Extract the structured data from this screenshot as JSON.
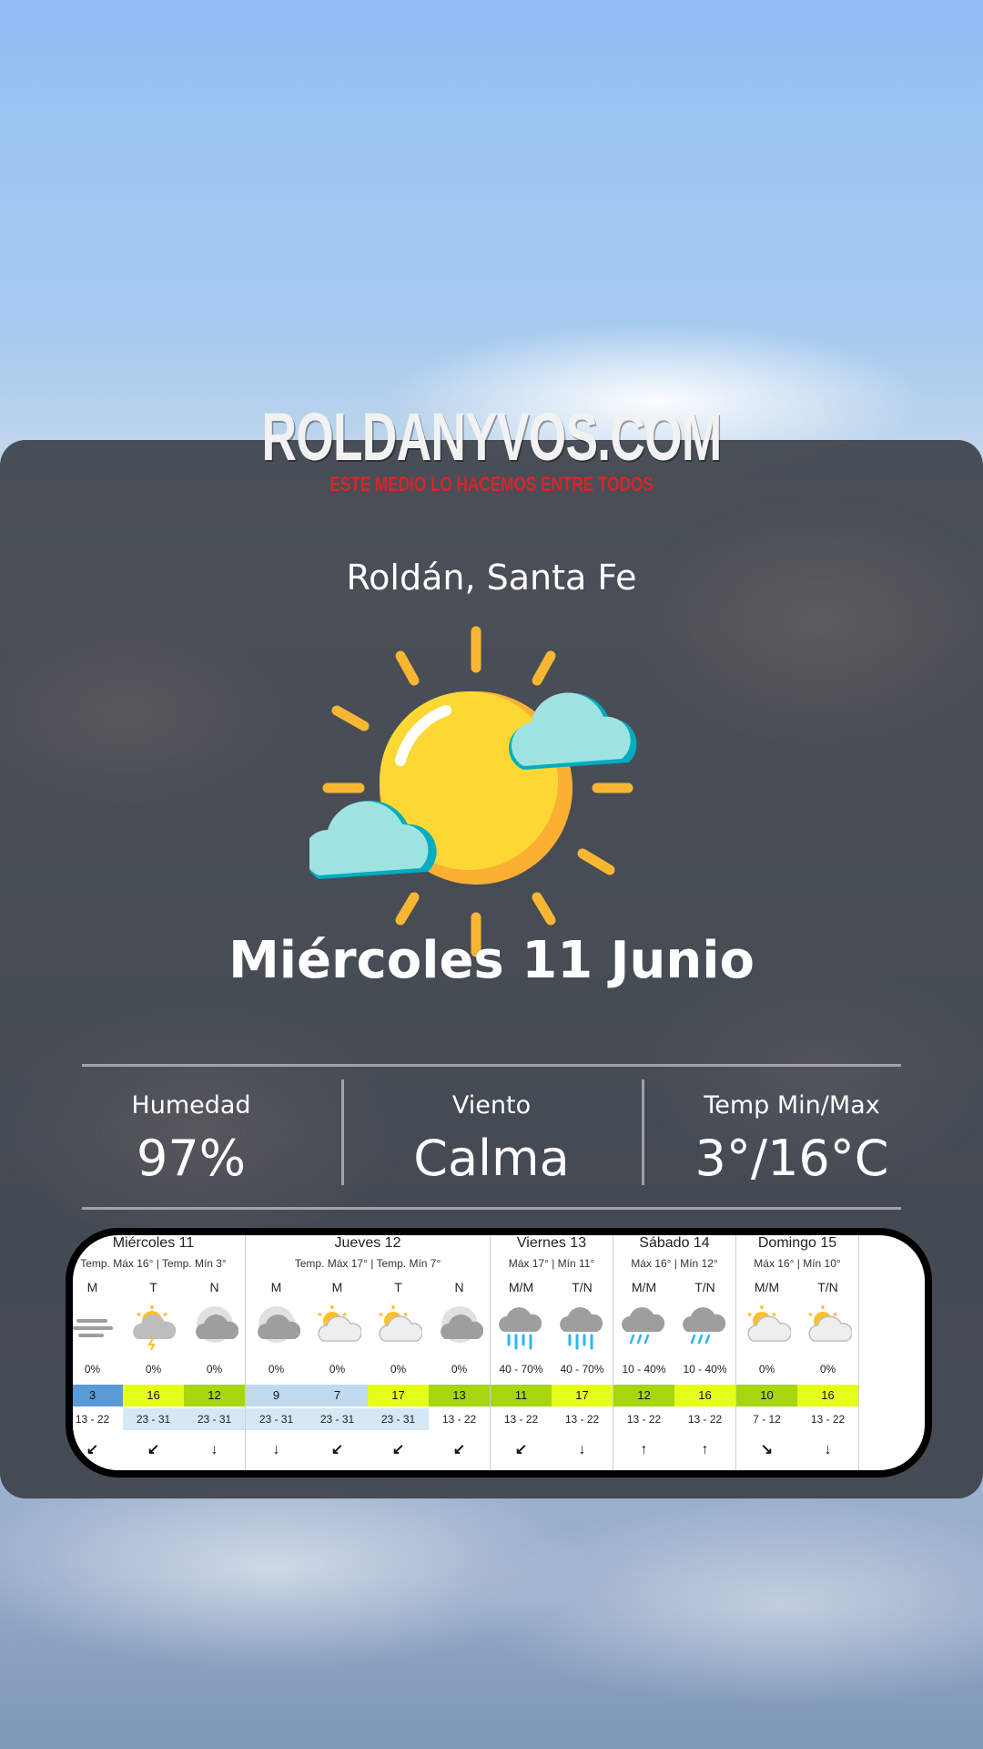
{
  "brand": {
    "logo_text": "ROLDANYVOS.COM",
    "tagline": "ESTE MEDIO LO HACEMOS ENTRE TODOS",
    "tagline_color": "#d4262b"
  },
  "location": "Roldán, Santa Fe",
  "main_icon": "sun-with-clouds-icon",
  "date": "Miércoles 11 Junio",
  "stats": {
    "humidity_label": "Humedad",
    "humidity_value": "97%",
    "wind_label": "Viento",
    "wind_value": "Calma",
    "temp_label": "Temp Min/Max",
    "temp_value": "3°/16°C"
  },
  "forecast": [
    {
      "title": "Miércoles 11",
      "subtitle": "Temp. Máx 16° | Temp. Mín 3°",
      "periods": [
        {
          "label": "M",
          "icon": "fog-icon",
          "prob": "0%",
          "index": "3",
          "index_color": "#5b9bd5",
          "range": "13 - 22",
          "range_bg": "#ffffff",
          "wind": "↙"
        },
        {
          "label": "T",
          "icon": "partly-cloudy-storm-icon",
          "prob": "0%",
          "index": "16",
          "index_color": "#e6ff1a",
          "range": "23 - 31",
          "range_bg": "#d6e7f5",
          "wind": "↙"
        },
        {
          "label": "N",
          "icon": "cloudy-night-icon",
          "prob": "0%",
          "index": "12",
          "index_color": "#a5d610",
          "range": "23 - 31",
          "range_bg": "#d6e7f5",
          "wind": "↓"
        }
      ]
    },
    {
      "title": "Jueves 12",
      "subtitle": "Temp. Máx 17° | Temp. Mín 7°",
      "periods": [
        {
          "label": "M",
          "icon": "cloudy-night-icon",
          "prob": "0%",
          "index": "9",
          "index_color": "#bfd9ef",
          "range": "23 - 31",
          "range_bg": "#d6e7f5",
          "wind": "↓"
        },
        {
          "label": "M",
          "icon": "partly-cloudy-icon",
          "prob": "0%",
          "index": "7",
          "index_color": "#bfd9ef",
          "range": "23 - 31",
          "range_bg": "#d6e7f5",
          "wind": "↙"
        },
        {
          "label": "T",
          "icon": "partly-cloudy-icon",
          "prob": "0%",
          "index": "17",
          "index_color": "#e6ff1a",
          "range": "23 - 31",
          "range_bg": "#d6e7f5",
          "wind": "↙"
        },
        {
          "label": "N",
          "icon": "cloudy-night-icon",
          "prob": "0%",
          "index": "13",
          "index_color": "#a5d610",
          "range": "13 - 22",
          "range_bg": "#ffffff",
          "wind": "↙"
        }
      ]
    },
    {
      "title": "Viernes 13",
      "subtitle": "Máx 17° | Mín 11°",
      "periods": [
        {
          "label": "M/M",
          "icon": "rain-icon",
          "prob": "40 - 70%",
          "index": "11",
          "index_color": "#a5d610",
          "range": "13 - 22",
          "range_bg": "#ffffff",
          "wind": "↙"
        },
        {
          "label": "T/N",
          "icon": "rain-icon",
          "prob": "40 - 70%",
          "index": "17",
          "index_color": "#e6ff1a",
          "range": "13 - 22",
          "range_bg": "#ffffff",
          "wind": "↓"
        }
      ]
    },
    {
      "title": "Sábado 14",
      "subtitle": "Máx 16° | Mín 12°",
      "periods": [
        {
          "label": "M/M",
          "icon": "light-rain-icon",
          "prob": "10 - 40%",
          "index": "12",
          "index_color": "#a5d610",
          "range": "13 - 22",
          "range_bg": "#ffffff",
          "wind": "↑"
        },
        {
          "label": "T/N",
          "icon": "light-rain-icon",
          "prob": "10 - 40%",
          "index": "16",
          "index_color": "#e6ff1a",
          "range": "13 - 22",
          "range_bg": "#ffffff",
          "wind": "↑"
        }
      ]
    },
    {
      "title": "Domingo 15",
      "subtitle": "Máx 16° | Mín 10°",
      "periods": [
        {
          "label": "M/M",
          "icon": "partly-cloudy-icon",
          "prob": "0%",
          "index": "10",
          "index_color": "#a5d610",
          "range": "7 - 12",
          "range_bg": "#ffffff",
          "wind": "↘"
        },
        {
          "label": "T/N",
          "icon": "partly-cloudy-icon",
          "prob": "0%",
          "index": "16",
          "index_color": "#e6ff1a",
          "range": "13 - 22",
          "range_bg": "#ffffff",
          "wind": "↓"
        }
      ]
    }
  ]
}
